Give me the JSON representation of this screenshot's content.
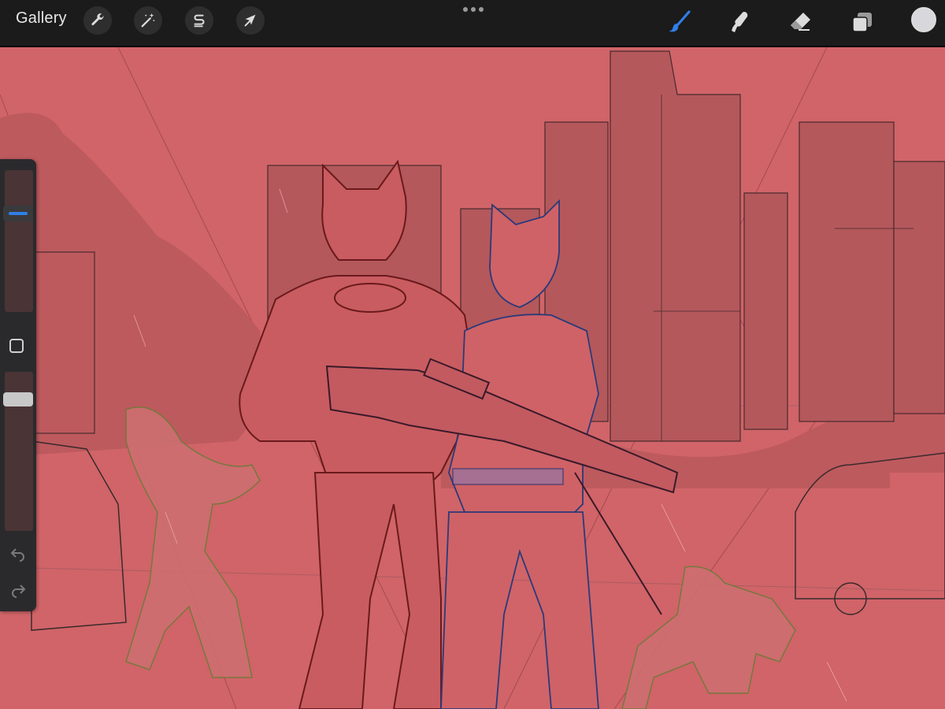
{
  "toolbar": {
    "gallery_label": "Gallery",
    "left_tools": [
      {
        "name": "actions",
        "icon": "wrench-icon"
      },
      {
        "name": "adjustments",
        "icon": "magic-wand-icon"
      },
      {
        "name": "selection",
        "icon": "selection-s-icon"
      },
      {
        "name": "transform",
        "icon": "arrow-cursor-icon"
      }
    ],
    "more_icon": "more-dots-icon",
    "right_tools": [
      {
        "name": "brush",
        "icon": "brush-icon",
        "active": true
      },
      {
        "name": "smudge",
        "icon": "smudge-finger-icon",
        "active": false
      },
      {
        "name": "eraser",
        "icon": "eraser-icon",
        "active": false
      },
      {
        "name": "layers",
        "icon": "layers-icon",
        "active": false
      }
    ],
    "current_color": "#d8d8dc"
  },
  "sidebar": {
    "brush_size_level": 0.72,
    "opacity_level": 0.86,
    "modify_button_icon": "square-modify-icon",
    "undo_icon": "undo-arrow-icon",
    "redo_icon": "redo-arrow-icon"
  },
  "canvas": {
    "background_color": "#d06468",
    "content": "artwork-sketch"
  },
  "colors": {
    "toolbar_bg": "#1b1b1b",
    "accent_blue": "#2f7fe8",
    "icon_light": "#dcdcdc"
  }
}
